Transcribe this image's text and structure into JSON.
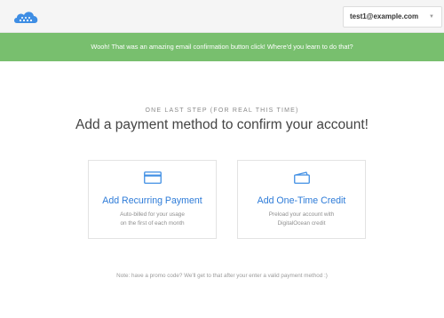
{
  "header": {
    "logo_icon": "digitalocean-cloud-logo-icon",
    "account_email": "test1@example.com",
    "account_caret_icon": "chevron-down-icon",
    "account_caret_glyph": "▼"
  },
  "banner": {
    "message": "Wooh! That was an amazing email confirmation button click! Where'd you learn to do that?"
  },
  "main": {
    "eyebrow": "ONE LAST STEP (FOR REAL THIS TIME)",
    "title": "Add a payment method to confirm your account!",
    "options": [
      {
        "icon": "credit-card-icon",
        "title": "Add Recurring Payment",
        "description_line1": "Auto-billed for your usage",
        "description_line2": "on the first of each month"
      },
      {
        "icon": "wallet-icon",
        "title": "Add One-Time Credit",
        "description_line1": "Preload your account with",
        "description_line2": "DigitalOcean credit"
      }
    ],
    "note": "Note: have a promo code? We'll get to that after your enter a valid payment method :)"
  },
  "colors": {
    "banner": "#78bf6e",
    "link_blue": "#2d7bd8",
    "logo_blue": "#3f8ee4"
  }
}
